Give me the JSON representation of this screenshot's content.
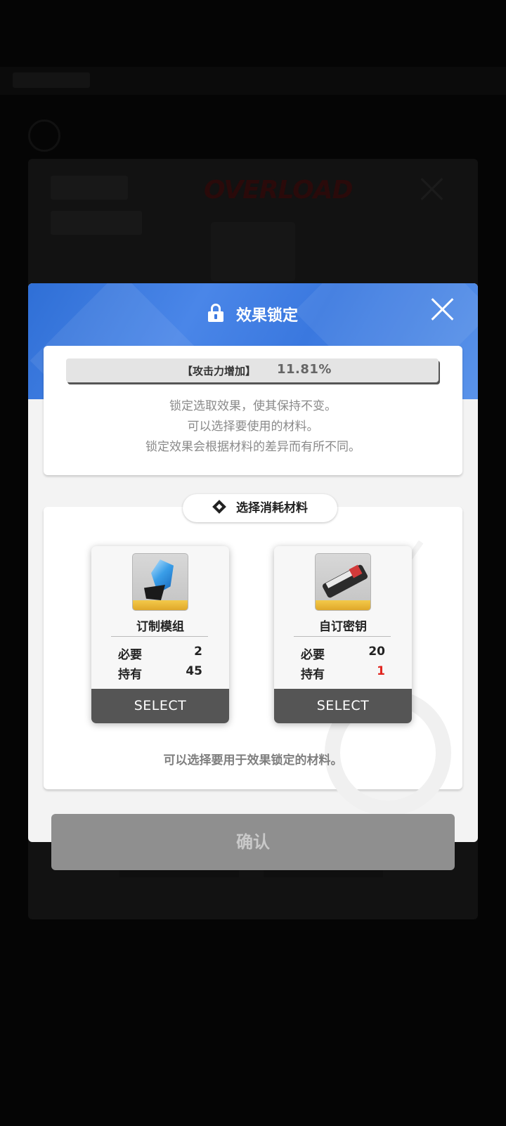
{
  "background": {
    "logo_text": "OVERLOAD"
  },
  "dialog": {
    "title": "效果锁定",
    "close_icon": "close-icon",
    "effect": {
      "name": "【攻击力增加】",
      "value": "11.81%",
      "description": [
        "锁定选取效果，使其保持不变。",
        "可以选择要使用的材料。",
        "锁定效果会根据材料的差异而有所不同。"
      ]
    },
    "materials_section": {
      "title": "选择消耗材料",
      "items": [
        {
          "name": "订制模组",
          "required_label": "必要",
          "required": "2",
          "owned_label": "持有",
          "owned": "45",
          "select_label": "SELECT",
          "icon": "crystal-module-icon"
        },
        {
          "name": "自订密钥",
          "required_label": "必要",
          "required": "20",
          "owned_label": "持有",
          "owned": "1",
          "select_label": "SELECT",
          "icon": "custom-key-icon"
        }
      ],
      "hint": "可以选择要用于效果锁定的材料。"
    },
    "confirm_label": "确认"
  },
  "colors": {
    "header_blue": "#3a78df",
    "insufficient_red": "#e0251f",
    "select_bar": "#555555",
    "confirm_disabled": "#8f8f8f"
  }
}
